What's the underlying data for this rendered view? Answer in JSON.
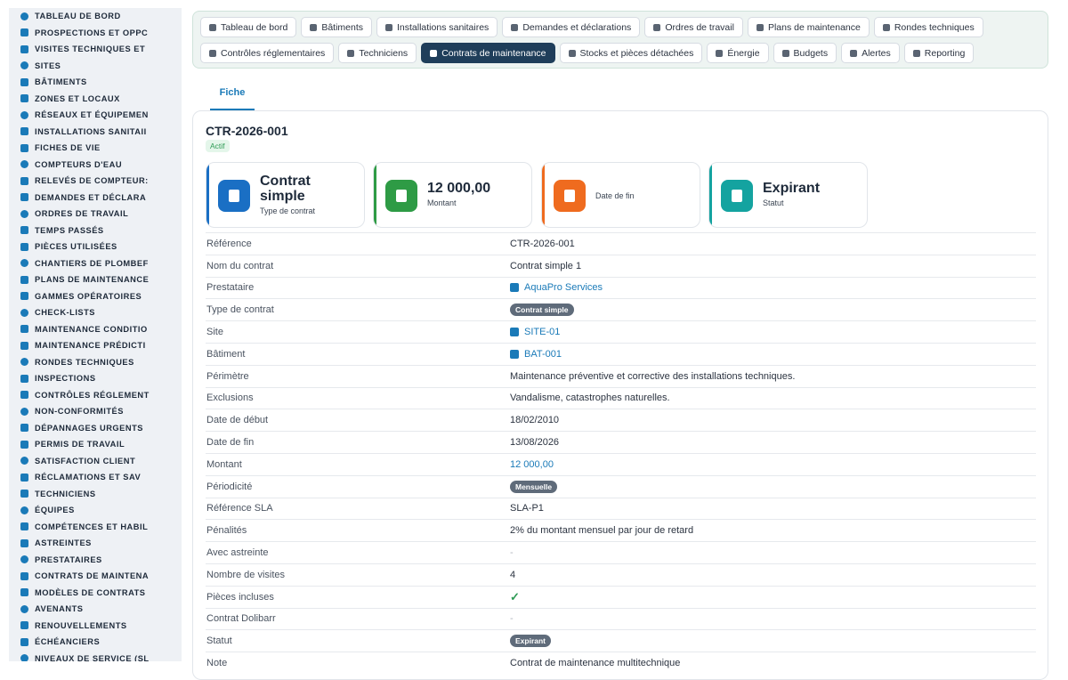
{
  "sidebar": {
    "items": [
      {
        "label": "TABLEAU DE BORD",
        "icon": "dashboard-icon"
      },
      {
        "label": "PROSPECTIONS ET OPPC",
        "icon": "target-icon"
      },
      {
        "label": "VISITES TECHNIQUES ET",
        "icon": "clipboard-icon"
      },
      {
        "label": "SITES",
        "icon": "map-pin-icon"
      },
      {
        "label": "BÂTIMENTS",
        "icon": "building-icon"
      },
      {
        "label": "ZONES ET LOCAUX",
        "icon": "grid-icon"
      },
      {
        "label": "RÉSEAUX ET ÉQUIPEMEN",
        "icon": "network-icon"
      },
      {
        "label": "INSTALLATIONS SANITAII",
        "icon": "cogs-icon"
      },
      {
        "label": "FICHES DE VIE",
        "icon": "history-icon"
      },
      {
        "label": "COMPTEURS D'EAU",
        "icon": "gauge-icon"
      },
      {
        "label": "RELEVÉS DE COMPTEUR:",
        "icon": "droplet-icon"
      },
      {
        "label": "DEMANDES ET DÉCLARA",
        "icon": "question-icon"
      },
      {
        "label": "ORDRES DE TRAVAIL",
        "icon": "clipboard-icon"
      },
      {
        "label": "TEMPS PASSÉS",
        "icon": "clock-icon"
      },
      {
        "label": "PIÈCES UTILISÉES",
        "icon": "boxes-icon"
      },
      {
        "label": "CHANTIERS DE PLOMBEF",
        "icon": "wrench-icon"
      },
      {
        "label": "PLANS DE MAINTENANCE",
        "icon": "calendar-icon"
      },
      {
        "label": "GAMMES OPÉRATOIRES",
        "icon": "list-icon"
      },
      {
        "label": "CHECK-LISTS",
        "icon": "checklist-icon"
      },
      {
        "label": "MAINTENANCE CONDITIO",
        "icon": "thermometer-icon"
      },
      {
        "label": "MAINTENANCE PRÉDICTI",
        "icon": "chart-line-icon"
      },
      {
        "label": "RONDES TECHNIQUES",
        "icon": "route-icon"
      },
      {
        "label": "INSPECTIONS",
        "icon": "search-icon"
      },
      {
        "label": "CONTRÔLES RÉGLEMENT",
        "icon": "clipboard-check-icon"
      },
      {
        "label": "NON-CONFORMITÉS",
        "icon": "exclamation-icon"
      },
      {
        "label": "DÉPANNAGES URGENTS",
        "icon": "warning-icon"
      },
      {
        "label": "PERMIS DE TRAVAIL",
        "icon": "file-icon"
      },
      {
        "label": "SATISFACTION CLIENT",
        "icon": "smile-icon"
      },
      {
        "label": "RÉCLAMATIONS ET SAV",
        "icon": "comment-icon"
      },
      {
        "label": "TECHNICIENS",
        "icon": "hard-hat-icon"
      },
      {
        "label": "ÉQUIPES",
        "icon": "users-icon"
      },
      {
        "label": "COMPÉTENCES ET HABIL",
        "icon": "certificate-icon"
      },
      {
        "label": "ASTREINTES",
        "icon": "phone-icon"
      },
      {
        "label": "PRESTATAIRES",
        "icon": "handshake-icon"
      },
      {
        "label": "CONTRATS DE MAINTENA",
        "icon": "file-contract-icon"
      },
      {
        "label": "MODÈLES DE CONTRATS",
        "icon": "file-icon"
      },
      {
        "label": "AVENANTS",
        "icon": "file-edit-icon"
      },
      {
        "label": "RENOUVELLEMENTS",
        "icon": "sync-icon"
      },
      {
        "label": "ÉCHÉANCIERS",
        "icon": "file-invoice-icon"
      },
      {
        "label": "NIVEAUX DE SERVICE (SL",
        "icon": "tachometer-icon"
      }
    ]
  },
  "nav": {
    "row1": [
      {
        "label": "Tableau de bord",
        "icon": "dashboard-icon"
      },
      {
        "label": "Bâtiments",
        "icon": "building-icon"
      },
      {
        "label": "Installations sanitaires",
        "icon": "cogs-icon"
      },
      {
        "label": "Demandes et déclarations",
        "icon": "question-icon"
      },
      {
        "label": "Ordres de travail",
        "icon": "clipboard-icon"
      },
      {
        "label": "Plans de maintenance",
        "icon": "calendar-icon"
      },
      {
        "label": "Rondes techniques",
        "icon": "route-icon"
      }
    ],
    "row2": [
      {
        "label": "Contrôles réglementaires",
        "icon": "clipboard-check-icon"
      },
      {
        "label": "Techniciens",
        "icon": "hard-hat-icon"
      },
      {
        "label": "Contrats de maintenance",
        "icon": "file-contract-icon",
        "active": true
      },
      {
        "label": "Stocks et pièces détachées",
        "icon": "boxes-icon"
      },
      {
        "label": "Énergie",
        "icon": "bolt-icon"
      },
      {
        "label": "Budgets",
        "icon": "money-icon"
      },
      {
        "label": "Alertes",
        "icon": "bell-icon"
      },
      {
        "label": "Reporting",
        "icon": "pie-chart-icon"
      }
    ]
  },
  "subtab": {
    "label": "Fiche"
  },
  "record": {
    "reference": "CTR-2026-001",
    "status_badge": "Actif"
  },
  "kpis": [
    {
      "big": "Contrat simple",
      "small": "Type de contrat",
      "color": "#1a6fc4",
      "icon": "file-contract-icon"
    },
    {
      "big": "12 000,00",
      "small": "Montant",
      "color": "#2e9b45",
      "icon": "coins-icon"
    },
    {
      "big": "",
      "small": "Date de fin",
      "color": "#ef6b1f",
      "icon": "calendar-x-icon"
    },
    {
      "big": "Expirant",
      "small": "Statut",
      "color": "#14a3a0",
      "icon": "info-icon"
    }
  ],
  "details": [
    {
      "key": "Référence",
      "value": "CTR-2026-001"
    },
    {
      "key": "Nom du contrat",
      "value": "Contrat simple 1"
    },
    {
      "key": "Prestataire",
      "value": "AquaPro Services",
      "type": "link",
      "icon": "building-icon"
    },
    {
      "key": "Type de contrat",
      "value": "Contrat simple",
      "type": "pill"
    },
    {
      "key": "Site",
      "value": "SITE-01",
      "type": "link",
      "icon": "site-icon"
    },
    {
      "key": "Bâtiment",
      "value": "BAT-001",
      "type": "link",
      "icon": "site-icon"
    },
    {
      "key": "Périmètre",
      "value": "Maintenance préventive et corrective des installations techniques."
    },
    {
      "key": "Exclusions",
      "value": "Vandalisme, catastrophes naturelles."
    },
    {
      "key": "Date de début",
      "value": "18/02/2010"
    },
    {
      "key": "Date de fin",
      "value": "13/08/2026"
    },
    {
      "key": "Montant",
      "value": "12 000,00",
      "type": "amount"
    },
    {
      "key": "Périodicité",
      "value": "Mensuelle",
      "type": "pill"
    },
    {
      "key": "Référence SLA",
      "value": "SLA-P1"
    },
    {
      "key": "Pénalités",
      "value": "2% du montant mensuel par jour de retard"
    },
    {
      "key": "Avec astreinte",
      "value": "-",
      "type": "muted"
    },
    {
      "key": "Nombre de visites",
      "value": "4"
    },
    {
      "key": "Pièces incluses",
      "value": "✓",
      "type": "check"
    },
    {
      "key": "Contrat Dolibarr",
      "value": "-",
      "type": "muted"
    },
    {
      "key": "Statut",
      "value": "Expirant",
      "type": "pill"
    },
    {
      "key": "Note",
      "value": "Contrat de maintenance multitechnique"
    }
  ]
}
